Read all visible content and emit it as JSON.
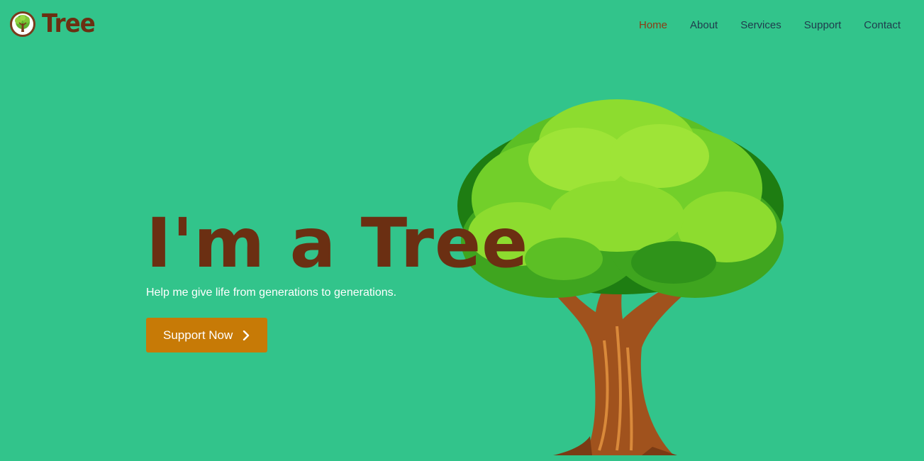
{
  "brand": {
    "name": "Tree",
    "logo_icon": "tree-logo-icon"
  },
  "nav": {
    "items": [
      {
        "label": "Home",
        "active": true
      },
      {
        "label": "About",
        "active": false
      },
      {
        "label": "Services",
        "active": false
      },
      {
        "label": "Support",
        "active": false
      },
      {
        "label": "Contact",
        "active": false
      }
    ]
  },
  "hero": {
    "title": "I'm a Tree",
    "subtitle": "Help me give life from generations to generations.",
    "cta_label": "Support Now",
    "cta_icon": "chevron-right-icon",
    "illustration": "tree-illustration"
  },
  "colors": {
    "background": "#32c48b",
    "brand_brown": "#6b2f12",
    "nav_active": "#8c3c14",
    "cta": "#c77a06"
  }
}
